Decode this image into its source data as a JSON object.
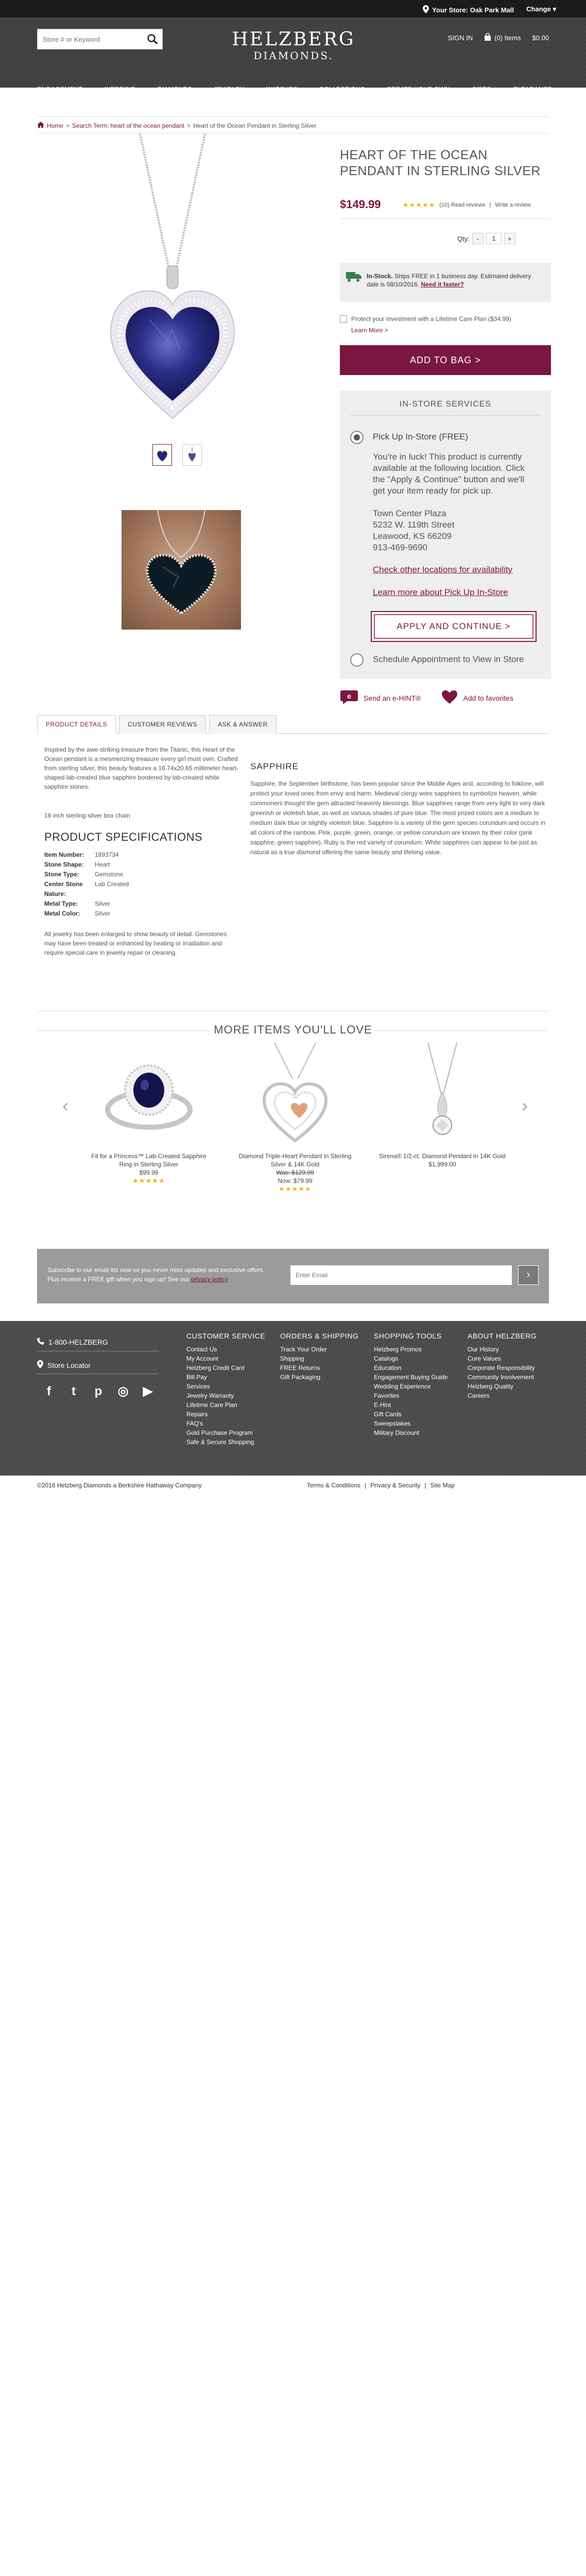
{
  "topbar": {
    "store_label": "Your Store: Oak Park Mall",
    "change_label": "Change"
  },
  "header": {
    "search_placeholder": "Store # or Keyword",
    "logo_line1": "HELZBERG",
    "logo_line2": "DIAMONDS.",
    "sign_in": "SIGN IN",
    "cart_items": "(0) Items",
    "cart_total": "$0.00"
  },
  "nav": [
    "ENGAGEMENT",
    "WEDDING",
    "DIAMONDS",
    "JEWELRY",
    "WATCHES",
    "COLLECTIONS",
    "CREATE YOUR OWN",
    "GIFTS",
    "CLEARANCE"
  ],
  "breadcrumb": {
    "home": "Home",
    "sep1": ">",
    "search": "Search Term: heart of the ocean pendant",
    "sep2": ">",
    "current": "Heart of the Ocean Pendant in Sterling Silver"
  },
  "product": {
    "title": "HEART OF THE OCEAN PENDANT IN STERLING SILVER",
    "price": "$149.99",
    "stars": "★★★★★",
    "rating_value": 5,
    "read_reviews": "(10) Read reviews",
    "write_review": "Write a review",
    "qty_label": "Qty:",
    "qty_minus": "-",
    "qty_value": "1",
    "qty_plus": "+",
    "stock_bold": "In-Stock.",
    "stock_text": " Ships FREE in 1 business day. Estimated delivery date is 08/10/2016.",
    "need_faster": "Need it faster?",
    "protect_text": "Protect your investment with a Lifetime Care Plan ($34.99)",
    "learn_more": "Learn More >",
    "add_to_bag": "ADD TO BAG >"
  },
  "instore": {
    "header": "IN-STORE SERVICES",
    "option1": "Pick Up In-Store (FREE)",
    "luck": "You're in luck! This product is currently available at the following location. Click the \"Apply & Continue\" button and we'll get your item ready for pick up.",
    "store_name": "Town Center Plaza",
    "store_street": "5232 W. 119th Street",
    "store_city": "Leawood, KS 66209",
    "store_phone": "913-469-9690",
    "check_other": "Check other locations for availability",
    "learn_pickup": "Learn more about Pick Up In-Store",
    "apply": "APPLY AND CONTINUE >",
    "option2": "Schedule Appointment to View in Store"
  },
  "share": {
    "ehint": "Send an e-HINT®",
    "favorites": "Add to favorites",
    "ehint_badge": "e"
  },
  "tabs": [
    "PRODUCT DETAILS",
    "CUSTOMER REVIEWS",
    "ASK & ANSWER"
  ],
  "details": {
    "description": "Inspired by the awe-striking treasure from the Titanic, this Heart of the Ocean pendant is a mesmerizing treasure every girl must own. Crafted from sterling silver, this beauty features a 16.74x20.65 millimeter heart-shaped lab-created blue sapphire bordered by lab-created white sapphire stones.",
    "chain": "18 inch sterling silver box chain",
    "spec_heading": "PRODUCT SPECIFICATIONS",
    "specs": [
      {
        "k": "Item Number:",
        "v": "1893734"
      },
      {
        "k": "Stone Shape:",
        "v": "Heart"
      },
      {
        "k": "Stone Type:",
        "v": "Gemstone"
      },
      {
        "k": "Center Stone Nature:",
        "v": "Lab Created"
      },
      {
        "k": "Metal Type:",
        "v": "Silver"
      },
      {
        "k": "Metal Color:",
        "v": "Silver"
      }
    ],
    "note": "All jewelry has been enlarged to show beauty of detail. Gemstones may have been treated or enhanced by heating or irradiation and require special care in jewelry repair or cleaning.",
    "sapphire_heading": "SAPPHIRE",
    "sapphire_text": "Sapphire, the September birthstone, has been popular since the Middle Ages and, according to folklore, will protect your loved ones from envy and harm. Medieval clergy wore sapphires to symbolize heaven, while commoners thought the gem attracted heavenly blessings. Blue sapphires range from very light to very dark greenish or violetish blue, as well as various shades of pure blue. The most prized colors are a medium to medium dark blue or slightly violetish blue. Sapphire is a variety of the gem species corundum and occurs in all colors of the rainbow. Pink, purple, green, orange, or yellow corundum are known by their color (pink sapphire, green sapphire). Ruby is the red variety of corundum. White sapphires can appear to be just as natural as a true diamond offering the same beauty and lifelong value."
  },
  "more": {
    "heading": "MORE ITEMS YOU'LL LOVE",
    "prev": "‹",
    "next": "›",
    "items": [
      {
        "name": "Fit for a Princess™ Lab-Created Sapphire Ring in Sterling Silver",
        "price": "$99.99",
        "stars": "★★★★★",
        "rating": 5
      },
      {
        "name": "Diamond Triple-Heart Pendant in Sterling Silver & 14K Gold",
        "was": "Was: $129.99",
        "now": "Now: $79.99",
        "stars": "★★★★★",
        "rating": 4
      },
      {
        "name": "Sirena® 1/2-ct. Diamond Pendant in 14K Gold",
        "price": "$1,999.00"
      }
    ]
  },
  "newsletter": {
    "text": "Subscribe to our email list now so you never miss updates and exclusive offers. Plus receive a FREE gift when you sign up! See our ",
    "privacy": "privacy policy",
    "placeholder": "Enter Email",
    "go": "›"
  },
  "footer": {
    "phone": "1-800-HELZBERG",
    "store_locator": "Store Locator",
    "social": [
      "f",
      "t",
      "p",
      "◎",
      "▶"
    ],
    "columns": [
      {
        "heading": "CUSTOMER SERVICE",
        "links": [
          "Contact Us",
          "My Account",
          "Helzberg Credit Card",
          "Bill Pay",
          "Services",
          "Jewelry Warranty",
          "Lifetime Care Plan",
          "Repairs",
          "FAQ's",
          "Gold Purchase Program",
          "Safe & Secure Shopping"
        ]
      },
      {
        "heading": "ORDERS & SHIPPING",
        "links": [
          "Track Your Order",
          "Shipping",
          "FREE Returns",
          "Gift Packaging"
        ]
      },
      {
        "heading": "SHOPPING TOOLS",
        "links": [
          "Helzberg Promos",
          "Catalogs",
          "Education",
          "Engagement Buying Guide",
          "Wedding Experience",
          "Favorites",
          "E-Hint",
          "Gift Cards",
          "Sweepstakes",
          "Military Discount"
        ]
      },
      {
        "heading": "ABOUT HELZBERG",
        "links": [
          "Our History",
          "Core Values",
          "Corporate Responsibility",
          "Community Involvement",
          "Helzberg Quality",
          "Careers"
        ]
      }
    ],
    "copyright": "©2016 Helzberg Diamonds a Berkshire Hathaway Company",
    "legal": [
      "Terms & Conditions",
      "|",
      "Privacy & Security",
      "|",
      "Site Map"
    ]
  },
  "colors": {
    "brand": "#7a1740",
    "header_bg": "#3f3f3f",
    "star": "#f0b400"
  }
}
